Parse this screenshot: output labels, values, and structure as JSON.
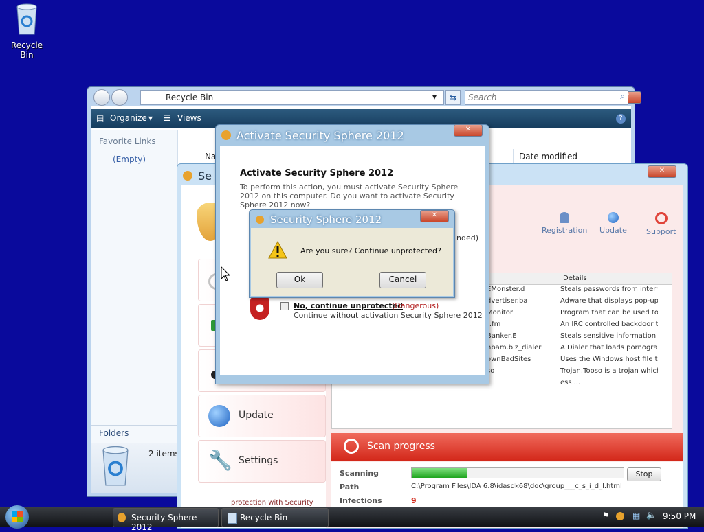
{
  "desktop": {
    "recycle_bin_label": "Recycle Bin"
  },
  "explorer": {
    "address": "Recycle Bin",
    "search_placeholder": "Search",
    "toolbar": {
      "organize": "Organize",
      "views": "Views"
    },
    "favorite_links": "Favorite Links",
    "empty": "(Empty)",
    "folders": "Folders",
    "columns": {
      "name_partial": "Na",
      "date_modified": "Date modified"
    },
    "items_count": "2 items"
  },
  "security_main": {
    "title_partial": "Se",
    "toolbar": {
      "registration": "Registration",
      "update": "Update",
      "support": "Support"
    },
    "nav": {
      "update": "Update",
      "settings": "Settings"
    },
    "bottom_text": "protection with Security",
    "grid_header_details": "Details",
    "threats": [
      {
        "name": "EMonster.d",
        "details": "Steals passwords from interne..."
      },
      {
        "name": "dvertiser.ba",
        "details": "Adware that displays pop-up/p..."
      },
      {
        "name": "Monitor",
        "details": "Program that can be used to ..."
      },
      {
        "name": "t.fm",
        "details": "An IRC controlled backdoor th..."
      },
      {
        "name": "Banker.E",
        "details": "Steals sensitive information fr..."
      },
      {
        "name": "nbam.biz_dialer",
        "details": "A Dialer that loads pornographi..."
      },
      {
        "name": "ownBadSites",
        "details": "Uses the Windows host file t..."
      },
      {
        "name": "so",
        "details": "Trojan.Tooso is a trojan which ..."
      },
      {
        "name": "",
        "details": "ess ..."
      }
    ],
    "scan_progress_label": "Scan progress",
    "scanning_label": "Scanning",
    "path_label": "Path",
    "path_value": "C:\\Program Files\\IDA 6.8\\idasdk68\\doc\\group___c_s_i_d_l.html",
    "infections_label": "Infections",
    "infections_value": "9",
    "stop_button": "Stop",
    "scan_progress": 0.26
  },
  "activate_dialog": {
    "title": "Activate Security Sphere 2012",
    "heading": "Activate Security Sphere 2012",
    "body": "To perform this action, you must activate Security Sphere 2012 on this computer. Do you want to activate Security Sphere 2012 now?",
    "recommended_partial": "nded)",
    "option_no_label": "No, continue unprotected",
    "option_no_tag": "(Dangerous)",
    "option_no_desc": "Continue without activation Security Sphere 2012"
  },
  "confirm_dialog": {
    "title": "Security Sphere 2012",
    "message": "Are you sure? Continue unprotected?",
    "ok": "Ok",
    "cancel": "Cancel"
  },
  "taskbar": {
    "tasks": [
      "Security Sphere 2012",
      "Recycle Bin"
    ],
    "time": "9:50 PM"
  }
}
